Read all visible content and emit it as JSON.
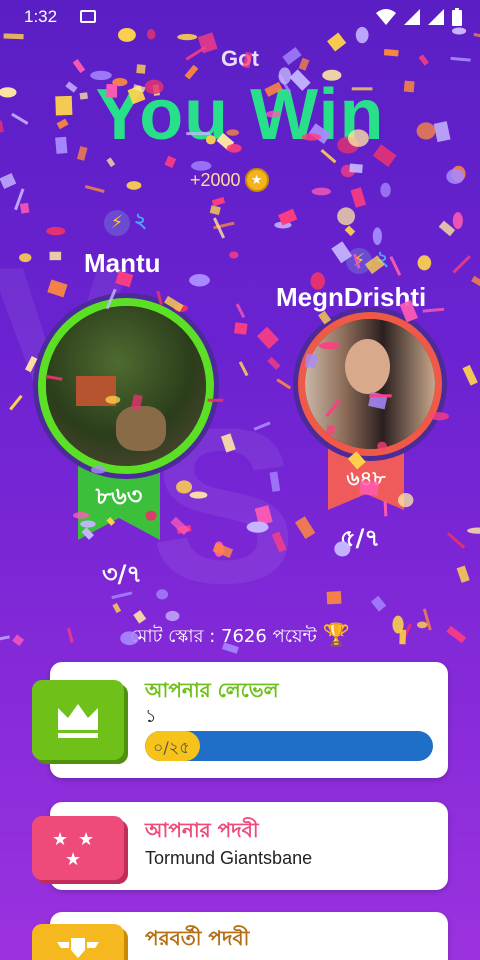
{
  "status_bar": {
    "time": "1:32"
  },
  "header": {
    "got_label": "Got",
    "title": "You Win",
    "coins_reward": "+2000"
  },
  "players": [
    {
      "name": "Mantu",
      "level": "২",
      "score": "৮৬৩",
      "correct": "৩/৭",
      "ring_color": "#5be026",
      "ribbon_color": "#3cbf3a"
    },
    {
      "name": "MegnDrishti",
      "level": "২",
      "score": "৬৪৮",
      "correct": "৫/৭",
      "ring_color": "#ef5a48",
      "ribbon_color": "#ef5a5a"
    }
  ],
  "total_score": "মোট স্কোর : 7626 পয়েন্ট",
  "cards": {
    "level": {
      "title": "আপনার লেভেল",
      "value": "১",
      "progress_text": "০/২৫",
      "progress": 0.19,
      "color": "#6fc019"
    },
    "rank": {
      "title": "আপনার পদবী",
      "value": "Tormund Giantsbane",
      "color": "#ef4b7a"
    },
    "next_rank": {
      "title": "পরবর্তী পদবী",
      "color": "#b46f12"
    }
  }
}
